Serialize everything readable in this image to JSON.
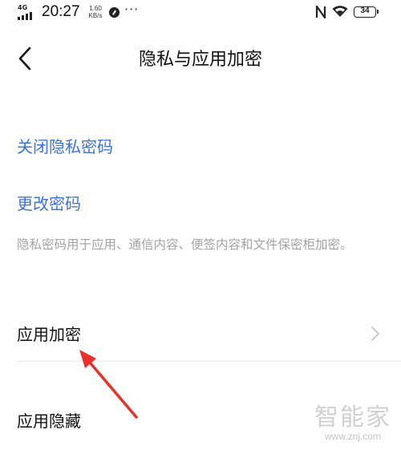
{
  "status_bar": {
    "network_type": "4G",
    "time": "20:27",
    "speed_value": "1.60",
    "speed_unit": "KB/s",
    "more_indicator": "···",
    "battery_level": "34",
    "icons": [
      "signal-icon",
      "app-notification-icon",
      "nfc-icon",
      "wifi-icon",
      "battery-icon"
    ]
  },
  "header": {
    "back_icon": "chevron-left-icon",
    "title": "隐私与应用加密"
  },
  "settings": {
    "close_privacy_password": "关闭隐私密码",
    "change_password": "更改密码",
    "description": "隐私密码用于应用、通信内容、便签内容和文件保密柜加密。",
    "app_encryption": "应用加密",
    "app_hiding": "应用隐藏",
    "chevron_icon": "chevron-right-icon"
  },
  "colors": {
    "link": "#3b72e8",
    "annotation_arrow": "#e8312a",
    "description_text": "#a3a3a3"
  },
  "watermark": {
    "logo": "智能家",
    "url": "www.znj.com"
  }
}
